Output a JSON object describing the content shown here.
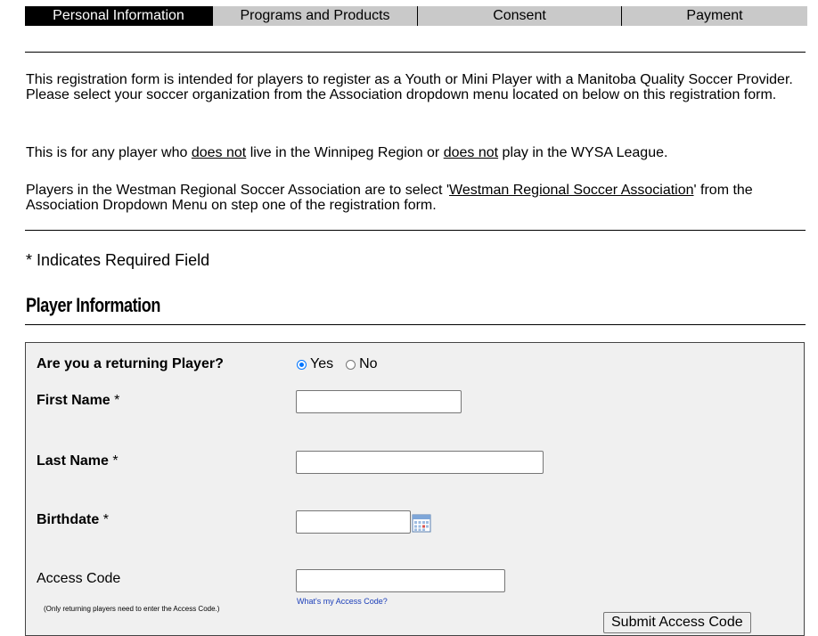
{
  "tabs": [
    {
      "label": "Personal Information",
      "active": true
    },
    {
      "label": "Programs and Products",
      "active": false
    },
    {
      "label": "Consent",
      "active": false
    },
    {
      "label": "Payment",
      "active": false
    }
  ],
  "intro": {
    "p1": "This registration form is intended for players to register as a Youth or Mini Player with a Manitoba Quality Soccer Provider. Please select your soccer organization from the Association dropdown menu located on below on this registration form.",
    "p2_a": "This is for any player who ",
    "p2_u1": "does not",
    "p2_b": " live in the Winnipeg Region or ",
    "p2_u2": "does not",
    "p2_c": " play in the WYSA League.",
    "p3_a": "Players in the Westman Regional Soccer Association are to select '",
    "p3_u": "Westman Regional Soccer Association",
    "p3_b": "' from the Association Dropdown Menu on step one of the registration form."
  },
  "required_note": "* Indicates Required Field",
  "section_title": "Player Information",
  "form": {
    "returning_label": "Are you a returning Player?",
    "returning_options": [
      {
        "label": "Yes",
        "checked": true
      },
      {
        "label": "No",
        "checked": false
      }
    ],
    "first_name_label": "First Name",
    "last_name_label": "Last Name",
    "birthdate_label": "Birthdate",
    "required_mark": "*",
    "access_code_label": "Access Code",
    "access_code_note": "(Only returning players need to enter the Access Code.)",
    "access_code_help": "What's my Access Code?",
    "submit_label": "Submit Access Code",
    "first_name_value": "",
    "last_name_value": "",
    "birthdate_value": "",
    "access_code_value": ""
  },
  "icons": {
    "calendar": "calendar-icon"
  },
  "colors": {
    "tab_active_bg": "#000000",
    "tab_bg": "#c9c9c9",
    "panel_bg": "#f0f0f0",
    "link": "#1a3db8",
    "radio_accent": "#0075ff"
  }
}
